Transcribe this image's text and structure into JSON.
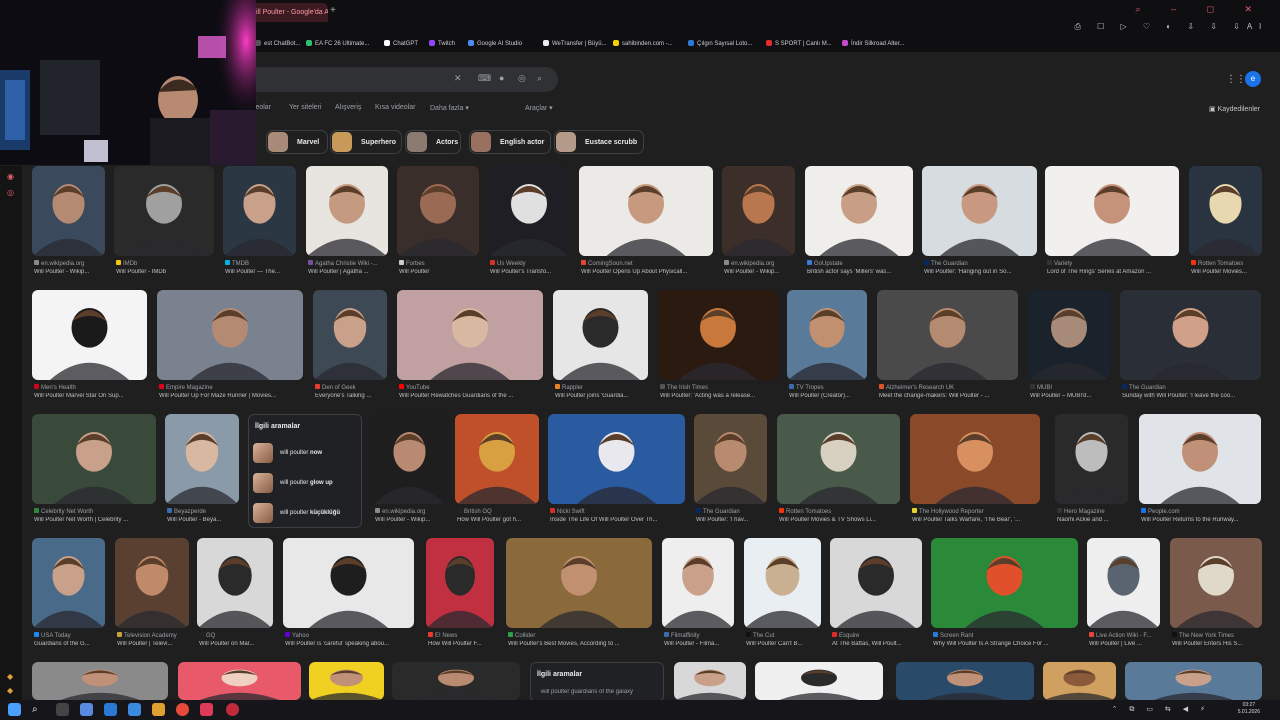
{
  "browser": {
    "tab_title": "ill Poulter - Google'da A",
    "new_tab_icon": "+",
    "window_controls": "⌕ – ◻ ✕",
    "toolbar_icons": "⎙ ☐ ▷ ♡ ◐ ⇩ ⇩ ⇩Al"
  },
  "bookmarks": [
    {
      "label": "est ChatBot...",
      "color": "#555555"
    },
    {
      "label": "EA FC 26 Ultimate...",
      "color": "#2fbf71"
    },
    {
      "label": "ChatGPT",
      "color": "#ffffff"
    },
    {
      "label": "Twitch",
      "color": "#9146ff"
    },
    {
      "label": "Google AI Studio",
      "color": "#4c8bf5"
    },
    {
      "label": "WeTransfer | Büyü...",
      "color": "#eeeeee"
    },
    {
      "label": "sahibinden.com -...",
      "color": "#f5d000"
    },
    {
      "label": "Çılgın Sayısal Loto...",
      "color": "#2a7ad5"
    },
    {
      "label": "S SPORT | Canlı M...",
      "color": "#e32b2b"
    },
    {
      "label": "İndir Silkroad Alter...",
      "color": "#c54ad0"
    }
  ],
  "google": {
    "nav_tabs": [
      "ideolar",
      "Yer siteleri",
      "Alışveriş",
      "Kısa videolar",
      "Daha fazla ▾",
      "Araçlar ▾"
    ],
    "saved_label": "Kaydedilenler",
    "avatar_letter": "e",
    "chips": [
      {
        "label": "Marvel",
        "color": "#a88a78"
      },
      {
        "label": "Superhero",
        "color": "#c79a5a"
      },
      {
        "label": "Actors",
        "color": "#8a7a70"
      },
      {
        "label": "English actor",
        "color": "#9a7060"
      },
      {
        "label": "Eustace scrubb",
        "color": "#b49a88"
      }
    ]
  },
  "results": [
    {
      "source": "en.wikipedia.org",
      "title": "Will Poulter - Wikip...",
      "c1": "#3a4a5c",
      "c2": "#b58a72",
      "sc": "#8a8a8a"
    },
    {
      "source": "IMDb",
      "title": "Will Poulter - IMDb",
      "c1": "#2a2a2a",
      "c2": "#a0a0a0",
      "sc": "#f5c518"
    },
    {
      "source": "TMDB",
      "title": "Will Poulter — The...",
      "c1": "#2b3742",
      "c2": "#c9a08a",
      "sc": "#01b4e4"
    },
    {
      "source": "Agatha Christie Wiki -...",
      "title": "Will Poulter | Agatha ...",
      "c1": "#e8e4e0",
      "c2": "#c49a80",
      "sc": "#7b4fa0"
    },
    {
      "source": "Forbes",
      "title": "Will Poulter",
      "c1": "#3a2e2a",
      "c2": "#9a6a55",
      "sc": "#cccccc"
    },
    {
      "source": "Us Weekly",
      "title": "Will Poulter's Transfo...",
      "c1": "#1e1e24",
      "c2": "#e0e0e0",
      "sc": "#d4312a"
    },
    {
      "source": "ComingSoon.net",
      "title": "Will Poulter Opens Up About Physicall...",
      "c1": "#eceae6",
      "c2": "#c79a80",
      "sc": "#e04a2a"
    },
    {
      "source": "en.wikipedia.org",
      "title": "Will Poulter - Wikip...",
      "c1": "#3c2e28",
      "c2": "#b8774e",
      "sc": "#8a8a8a"
    },
    {
      "source": "GoUpstate",
      "title": "British actor says 'Millers' was...",
      "c1": "#f0eeea",
      "c2": "#c89f86",
      "sc": "#3a7bd5"
    },
    {
      "source": "The Guardian",
      "title": "Will Poulter: 'Hanging out in So...",
      "c1": "#d6dce0",
      "c2": "#c99880",
      "sc": "#052962"
    },
    {
      "source": "Variety",
      "title": "Lord of The Rings' Series at Amazon ...",
      "c1": "#f2f0ee",
      "c2": "#c5927a",
      "sc": "#333333"
    },
    {
      "source": "Rotten Tomatoes",
      "title": "Will Poulter Movies...",
      "c1": "#2a3440",
      "c2": "#e8d8b0",
      "sc": "#fa320a"
    },
    {
      "source": "Men's Health",
      "title": "Will Poulter Marvel Star On Sup...",
      "c1": "#f4f4f4",
      "c2": "#1a1a1a",
      "sc": "#d0021b"
    },
    {
      "source": "Empire Magazine",
      "title": "Will Poulter Up For Maze Runner | Movies...",
      "c1": "#7a8290",
      "c2": "#b58a72",
      "sc": "#e2001a"
    },
    {
      "source": "Den of Geek",
      "title": "Everyone's Talking ...",
      "c1": "#3d4a55",
      "c2": "#c9a08a",
      "sc": "#e63b2e"
    },
    {
      "source": "YouTube",
      "title": "Will Poulter Rewatches Guardians of the ...",
      "c1": "#c0a0a0",
      "c2": "#d8b8a0",
      "sc": "#ff0000"
    },
    {
      "source": "Rappler",
      "title": "Will Poulter joins 'Guardia...",
      "c1": "#e6e6e6",
      "c2": "#2a2a2a",
      "sc": "#e8832a"
    },
    {
      "source": "The Irish Times",
      "title": "Will Poulter: 'Acting was a release...",
      "c1": "#2a1a10",
      "c2": "#c8783a",
      "sc": "#555555"
    },
    {
      "source": "TV Tropes",
      "title": "Will Poulter (Creator)...",
      "c1": "#5a7a9a",
      "c2": "#c09070",
      "sc": "#3a6ab0"
    },
    {
      "source": "Alzheimer's Research UK",
      "title": "Meet the change-makers: Will Poulter - ...",
      "c1": "#4a4a4a",
      "c2": "#b48a70",
      "sc": "#e0522a"
    },
    {
      "source": "MUBI",
      "title": "Will Poulter – MUBI'd...",
      "c1": "#1a222c",
      "c2": "#a88a78",
      "sc": "#333333"
    },
    {
      "source": "The Guardian",
      "title": "Sunday with Will Poulter: 'I leave the coo...",
      "c1": "#2a2e36",
      "c2": "#d0a088",
      "sc": "#052962"
    },
    {
      "source": "Celebrity Net Worth",
      "title": "Will Poulter Net Worth | Celebrity ...",
      "c1": "#3a4a3a",
      "c2": "#c9a08a",
      "sc": "#2a8a3a"
    },
    {
      "source": "Beyazperde",
      "title": "Will Poulter - Beya...",
      "c1": "#8a9aa8",
      "c2": "#d8b8a0",
      "sc": "#3a6ab0"
    },
    {
      "source": "en.wikipedia.org",
      "title": "Will Poulter - Wikip...",
      "c1": "#1e1e1e",
      "c2": "#b88a72",
      "sc": "#8a8a8a"
    },
    {
      "source": "British GQ",
      "title": "How Will Poulter got h...",
      "c1": "#c0502a",
      "c2": "#d8a040",
      "sc": "#222222"
    },
    {
      "source": "Nicki Swift",
      "title": "Inside The Life Of Will Poulter Over Th...",
      "c1": "#2a5aa0",
      "c2": "#e8e8ee",
      "sc": "#d4312a"
    },
    {
      "source": "The Guardian",
      "title": "Will Poulter: 'I hav...",
      "c1": "#5a4a3a",
      "c2": "#b88a70",
      "sc": "#052962"
    },
    {
      "source": "Rotten Tomatoes",
      "title": "Will Poulter Movies & TV Shows Li...",
      "c1": "#4a5a4a",
      "c2": "#d8d0c0",
      "sc": "#fa320a"
    },
    {
      "source": "The Hollywood Reporter",
      "title": "Will Poulter Talks Warfare, 'The Bear', '...",
      "c1": "#8a4a2a",
      "c2": "#d89060",
      "sc": "#e8d02a"
    },
    {
      "source": "Hero Magazine",
      "title": "Naomi Ackie and ...",
      "c1": "#2a2a2a",
      "c2": "#bdbdbd",
      "sc": "#333333"
    },
    {
      "source": "People.com",
      "title": "Will Poulter Returns to the Runway...",
      "c1": "#e0e4e8",
      "c2": "#c09078",
      "sc": "#1a73e8"
    },
    {
      "source": "USA Today",
      "title": "Guardians of the G...",
      "c1": "#4a6a8a",
      "c2": "#c9a08a",
      "sc": "#1a8cf0"
    },
    {
      "source": "Television Academy",
      "title": "Will Poulter | Televi...",
      "c1": "#5a4030",
      "c2": "#c08a6a",
      "sc": "#c8a040"
    },
    {
      "source": "GQ",
      "title": "Will Poulter on Mar...",
      "c1": "#d8d8d8",
      "c2": "#2a2a2a",
      "sc": "#222222"
    },
    {
      "source": "Yahoo",
      "title": "Will Poulter is 'careful' speaking abou...",
      "c1": "#e8e8e8",
      "c2": "#1e1e1e",
      "sc": "#6001d2"
    },
    {
      "source": "E! News",
      "title": "How Will Poulter F...",
      "c1": "#c03040",
      "c2": "#2a2a2a",
      "sc": "#e83a2a"
    },
    {
      "source": "Collider",
      "title": "Will Poulter's Best Movies, According to ...",
      "c1": "#8a6a3a",
      "c2": "#c09070",
      "sc": "#2aa04a"
    },
    {
      "source": "Filmaffinity",
      "title": "Will Poulter - Filma...",
      "c1": "#eeeeee",
      "c2": "#c9a08a",
      "sc": "#3a6ab0"
    },
    {
      "source": "The Cut",
      "title": "Will Poulter Can't B...",
      "c1": "#e8eef2",
      "c2": "#c9b090",
      "sc": "#111111"
    },
    {
      "source": "Esquire",
      "title": "At The Baftas, Will Poult...",
      "c1": "#d8d8d8",
      "c2": "#2a2a2a",
      "sc": "#e02a2a"
    },
    {
      "source": "Screen Rant",
      "title": "Why Will Poulter Is A Strange Choice For ...",
      "c1": "#2a8a3a",
      "c2": "#e0502a",
      "sc": "#2a7ad5"
    },
    {
      "source": "Live Action Wiki - F...",
      "title": "Will Poulter | Live ...",
      "c1": "#eeeeee",
      "c2": "#5a6470",
      "sc": "#e8443a"
    },
    {
      "source": "The New York Times",
      "title": "Will Poulter Enters His S...",
      "c1": "#7a5a4a",
      "c2": "#e0d8c8",
      "sc": "#111111"
    },
    {
      "c1": "#8a8a8a",
      "c2": "#c09078"
    },
    {
      "c1": "#e85a6a",
      "c2": "#f0d0c0"
    },
    {
      "c1": "#f0d020",
      "c2": "#c09078"
    },
    {
      "c1": "#2a2a2a",
      "c2": "#b88a70"
    },
    {
      "c1": "#d8d8d8",
      "c2": "#c9a08a"
    },
    {
      "c1": "#f0f0f0",
      "c2": "#2a2a2a"
    },
    {
      "c1": "#2a4a6a",
      "c2": "#c09078"
    },
    {
      "c1": "#d0a060",
      "c2": "#8a5a3a"
    },
    {
      "c1": "#5a7a9a",
      "c2": "#c9a08a"
    }
  ],
  "related_searches": {
    "title": "İlgili aramalar",
    "items": [
      {
        "base": "will poulter",
        "bold": "now"
      },
      {
        "base": "will poulter",
        "bold": "glow up"
      },
      {
        "base": "will poulter",
        "bold": "küçüklüğü"
      }
    ]
  },
  "related_searches_2": {
    "title": "İlgili aramalar",
    "item": "will poulter guardians of the galaxy"
  },
  "taskbar": {
    "time": "03:27",
    "date": "5.01.2026",
    "tray": "⌃ ⧉ ▭ ⇆ ◀ ⚡"
  }
}
